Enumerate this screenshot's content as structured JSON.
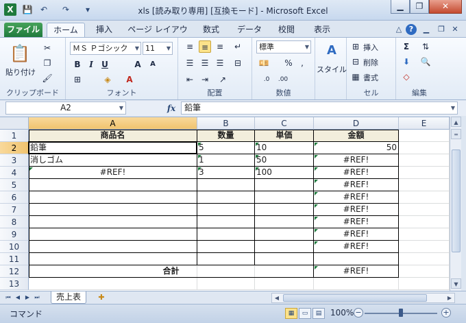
{
  "window": {
    "title": "xls  [読み取り専用]  [互換モード]  -  Microsoft Excel",
    "logo_letter": "X",
    "minimize": "▁",
    "restore": "❐",
    "close": "✕"
  },
  "quick_access": [
    "💾",
    "↶",
    "↷",
    "▾"
  ],
  "ribbon_tabs": [
    "ファイル",
    "ホーム",
    "挿入",
    "ページ レイアウト",
    "数式",
    "データ",
    "校閲",
    "表示"
  ],
  "ribbon_right_icons": [
    "△",
    "?",
    "▁",
    "❐",
    "✕"
  ],
  "ribbon": {
    "clipboard": {
      "name": "クリップボード",
      "paste": "貼り付け"
    },
    "font": {
      "name": "フォント",
      "font_name": "ＭＳ Ｐゴシック",
      "font_size": "11",
      "bold": "B",
      "italic": "I",
      "underline": "U",
      "grow": "A",
      "shrink": "A"
    },
    "alignment": {
      "name": "配置"
    },
    "number": {
      "name": "数値",
      "format": "標準",
      "percent": "%",
      "comma": ","
    },
    "styles": {
      "label": "スタイル"
    },
    "cells": {
      "name": "セル",
      "insert": "挿入",
      "delete": "削除",
      "format": "書式"
    },
    "editing": {
      "name": "編集",
      "sigma": "Σ"
    }
  },
  "formula_bar": {
    "name_box": "A2",
    "fx": "fx",
    "value": "鉛筆"
  },
  "columns": [
    "A",
    "B",
    "C",
    "D",
    "E"
  ],
  "rows": [
    "1",
    "2",
    "3",
    "4",
    "5",
    "6",
    "7",
    "8",
    "9",
    "10",
    "11",
    "12",
    "13"
  ],
  "table": {
    "header": [
      "商品名",
      "数量",
      "単価",
      "金額"
    ],
    "rows": [
      [
        "鉛筆",
        "5",
        "10",
        "50"
      ],
      [
        "消しゴム",
        "1",
        "50",
        "#REF!"
      ],
      [
        "#REF!",
        "3",
        "100",
        "#REF!"
      ],
      [
        "",
        "",
        "",
        "#REF!"
      ],
      [
        "",
        "",
        "",
        "#REF!"
      ],
      [
        "",
        "",
        "",
        "#REF!"
      ],
      [
        "",
        "",
        "",
        "#REF!"
      ],
      [
        "",
        "",
        "",
        "#REF!"
      ],
      [
        "",
        "",
        "",
        "#REF!"
      ]
    ],
    "total_label": "合計",
    "total_value": "#REF!"
  },
  "sheet_tab": "売上表",
  "status": {
    "mode": "コマンド",
    "zoom": "100%",
    "minus": "−",
    "plus": "+"
  },
  "colors": {
    "header_fill": "#f2eedc",
    "selection_header": "#f0c36e",
    "error_triangle": "#1f7a3d"
  }
}
